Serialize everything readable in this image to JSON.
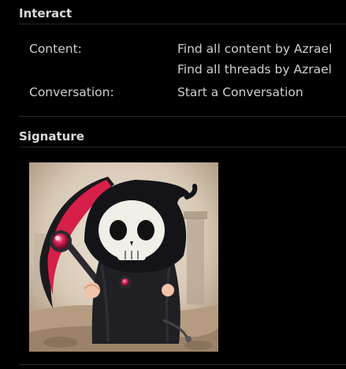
{
  "interact": {
    "title": "Interact",
    "content_label": "Content:",
    "content_links": [
      "Find all content by Azrael",
      "Find all threads by Azrael"
    ],
    "conversation_label": "Conversation:",
    "conversation_link": "Start a Conversation"
  },
  "signature": {
    "title": "Signature",
    "image_subject": "chibi-grim-reaper-with-scythe"
  },
  "colors": {
    "background": "#000000",
    "text": "#cfcfcf",
    "heading": "#dcdcdc",
    "divider": "#2a2a2a",
    "scythe_accent": "#d6204a"
  }
}
